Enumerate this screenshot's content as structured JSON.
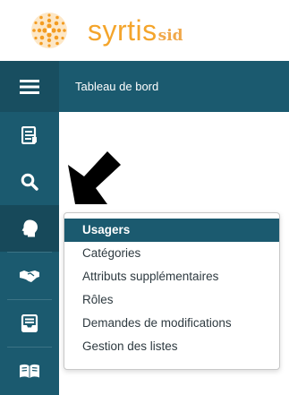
{
  "brand": {
    "name": "syrtis",
    "suffix": "sid",
    "color_main": "#f4a52c",
    "color_mark": "#f39c22"
  },
  "header": {
    "title": "Tableau de bord",
    "menu_icon": "hamburger-menu-icon",
    "background": "#1b5a6f"
  },
  "sidebar": {
    "items": [
      {
        "icon": "document-list-icon",
        "active": false
      },
      {
        "icon": "search-icon",
        "active": false
      },
      {
        "icon": "user-head-icon",
        "active": true
      },
      {
        "icon": "handshake-icon",
        "active": false
      },
      {
        "icon": "inbox-tray-icon",
        "active": false
      },
      {
        "icon": "open-book-icon",
        "active": false
      }
    ]
  },
  "dropdown": {
    "items": [
      {
        "label": "Usagers",
        "active": true
      },
      {
        "label": "Catégories",
        "active": false
      },
      {
        "label": "Attributs supplémentaires",
        "active": false
      },
      {
        "label": "Rôles",
        "active": false
      },
      {
        "label": "Demandes de modifications",
        "active": false
      },
      {
        "label": "Gestion des listes",
        "active": false
      }
    ]
  },
  "annotation": {
    "icon": "black-pointer-arrow-icon"
  }
}
